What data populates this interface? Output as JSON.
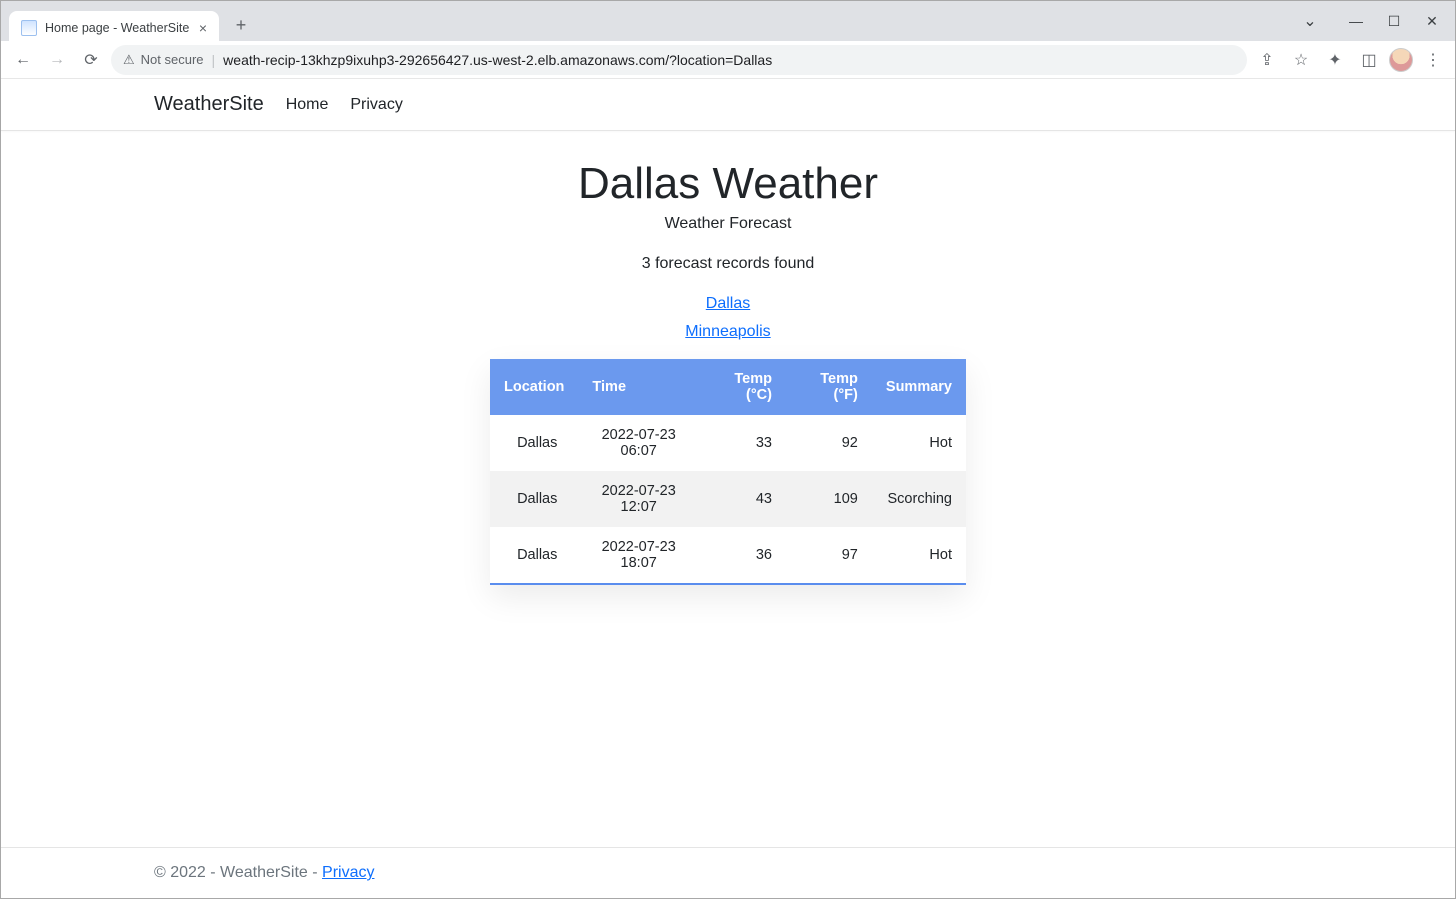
{
  "browser": {
    "tab_title": "Home page - WeatherSite",
    "not_secure_label": "Not secure",
    "url": "weath-recip-13khzp9ixuhp3-292656427.us-west-2.elb.amazonaws.com/?location=Dallas"
  },
  "navbar": {
    "brand": "WeatherSite",
    "links": {
      "home": "Home",
      "privacy": "Privacy"
    }
  },
  "page": {
    "title": "Dallas Weather",
    "subtitle": "Weather Forecast",
    "records_found": "3 forecast records found",
    "city_links": {
      "dallas": "Dallas",
      "minneapolis": "Minneapolis"
    }
  },
  "table": {
    "headers": {
      "location": "Location",
      "time": "Time",
      "temp_c": "Temp (°C)",
      "temp_f": "Temp (°F)",
      "summary": "Summary"
    },
    "rows": [
      {
        "location": "Dallas",
        "time": "2022-07-23 06:07",
        "temp_c": "33",
        "temp_f": "92",
        "summary": "Hot"
      },
      {
        "location": "Dallas",
        "time": "2022-07-23 12:07",
        "temp_c": "43",
        "temp_f": "109",
        "summary": "Scorching"
      },
      {
        "location": "Dallas",
        "time": "2022-07-23 18:07",
        "temp_c": "36",
        "temp_f": "97",
        "summary": "Hot"
      }
    ]
  },
  "footer": {
    "copyright": "© 2022 - WeatherSite - ",
    "privacy_link": "Privacy"
  }
}
